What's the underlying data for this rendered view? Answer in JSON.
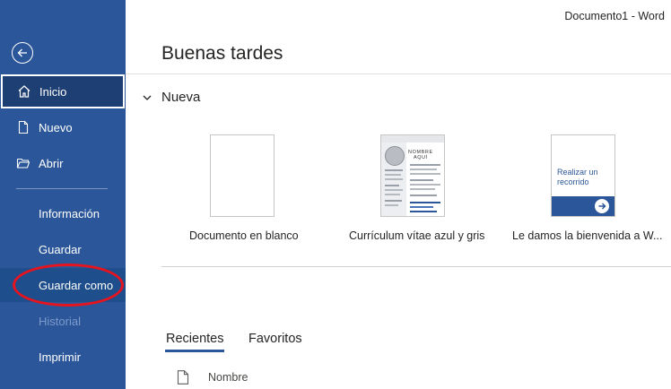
{
  "window": {
    "title": "Documento1  -  Word"
  },
  "sidebar": {
    "items": [
      {
        "label": "Inicio"
      },
      {
        "label": "Nuevo"
      },
      {
        "label": "Abrir"
      },
      {
        "label": "Información"
      },
      {
        "label": "Guardar"
      },
      {
        "label": "Guardar como"
      },
      {
        "label": "Historial"
      },
      {
        "label": "Imprimir"
      }
    ],
    "selected": "Inicio",
    "disabled": [
      "Historial"
    ],
    "accent_color": "#2b579a",
    "annotation_color": "#e5141f"
  },
  "main": {
    "greeting": "Buenas tardes",
    "new_section": {
      "title": "Nueva",
      "templates": [
        {
          "label": "Documento en blanco"
        },
        {
          "label": "Currículum vítae azul y gris",
          "thumb_name_line1": "NOMBRE",
          "thumb_name_line2": "AQUÍ"
        },
        {
          "label": "Le damos la bienvenida a W...",
          "thumb_text": "Realizar un recorrido"
        }
      ]
    },
    "tabs": [
      {
        "label": "Recientes",
        "active": true
      },
      {
        "label": "Favoritos",
        "active": false
      }
    ],
    "list": {
      "column_name": "Nombre"
    }
  }
}
